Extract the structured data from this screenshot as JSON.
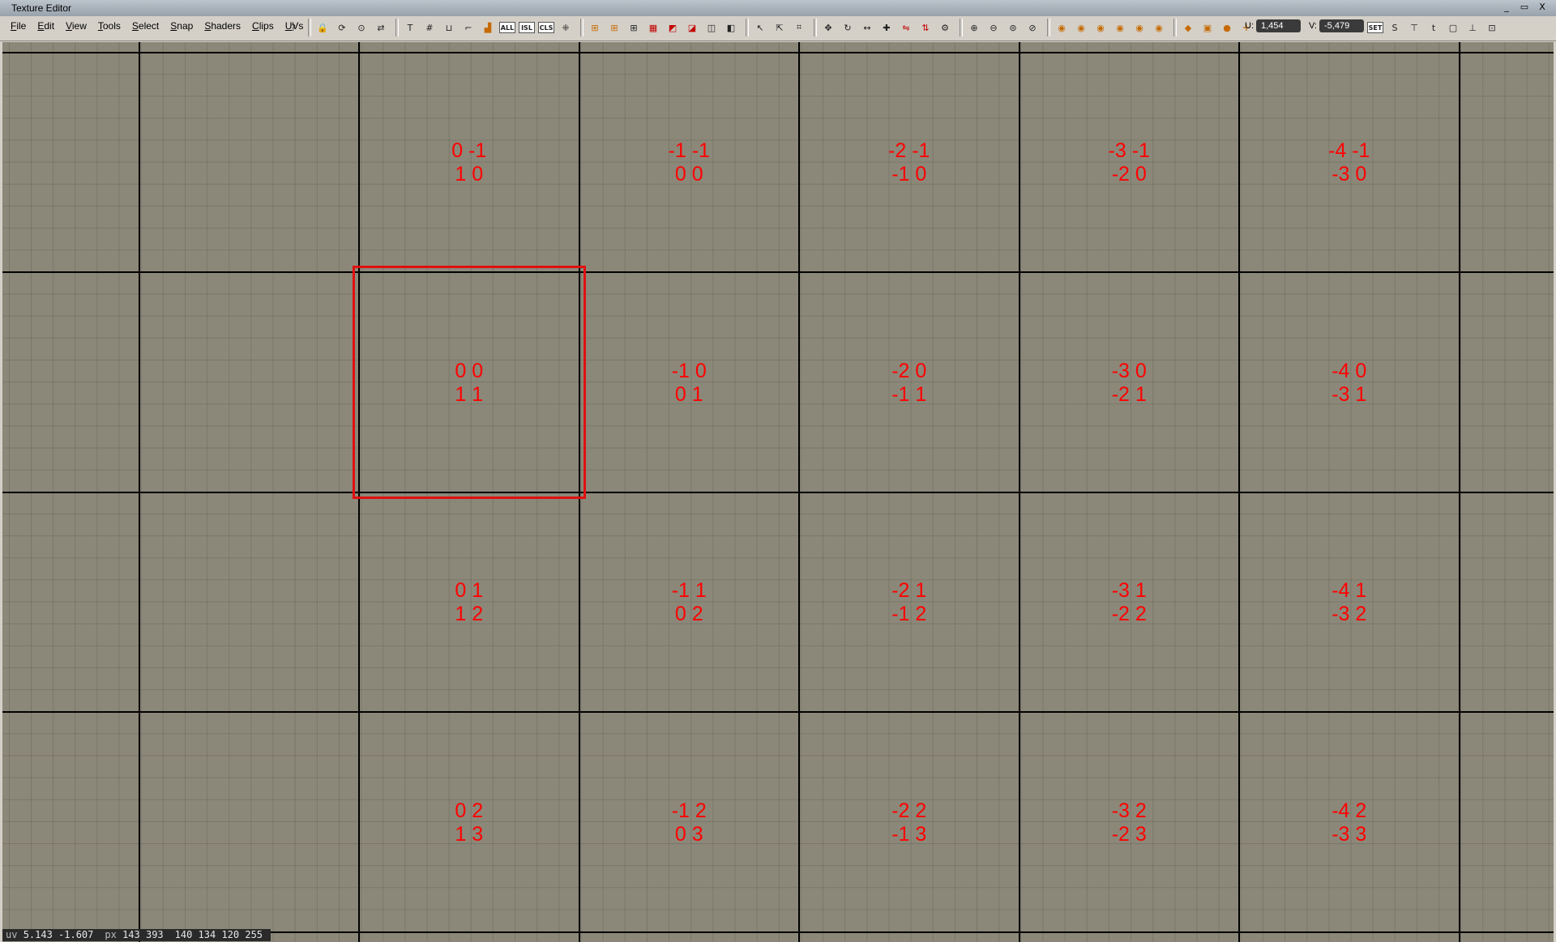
{
  "window": {
    "title": "Texture Editor",
    "minimize": "_",
    "restore": "▭",
    "close": "X"
  },
  "menu": [
    "File",
    "Edit",
    "View",
    "Tools",
    "Select",
    "Snap",
    "Shaders",
    "Clips",
    "UVs"
  ],
  "toolbar": {
    "icons": [
      {
        "name": "help-icon",
        "glyph": "?"
      },
      {
        "sep": true
      },
      {
        "name": "lock-icon",
        "glyph": "🔒"
      },
      {
        "name": "refresh-icon",
        "glyph": "⟳"
      },
      {
        "name": "snapshot-icon",
        "glyph": "⊙"
      },
      {
        "name": "swap-icon",
        "glyph": "⇄"
      },
      {
        "sep": true
      },
      {
        "name": "text-icon",
        "glyph": "T"
      },
      {
        "name": "grid-icon",
        "glyph": "#"
      },
      {
        "name": "uv-icon",
        "glyph": "⊔"
      },
      {
        "name": "edge-icon",
        "glyph": "⌐"
      },
      {
        "name": "paint-icon",
        "glyph": "▟",
        "cls": "orange"
      },
      {
        "name": "all-button",
        "text": "ALL"
      },
      {
        "name": "isl-button",
        "text": "ISL"
      },
      {
        "name": "cls-button",
        "text": "CLS"
      },
      {
        "name": "pattern-icon",
        "glyph": "⁜"
      },
      {
        "sep": true
      },
      {
        "name": "snap-grid-icon",
        "glyph": "⊞",
        "cls": "orange"
      },
      {
        "name": "snap-points-icon",
        "glyph": "⊞",
        "cls": "orange"
      },
      {
        "name": "snap-edge-icon",
        "glyph": "⊞"
      },
      {
        "name": "checker-icon",
        "glyph": "▦",
        "cls": "red"
      },
      {
        "name": "texture-icon",
        "glyph": "◩",
        "cls": "red"
      },
      {
        "name": "image-icon",
        "glyph": "◪",
        "cls": "red"
      },
      {
        "name": "stamp-icon",
        "glyph": "◫"
      },
      {
        "name": "mirror-icon",
        "glyph": "◧"
      },
      {
        "sep": true
      },
      {
        "name": "pointer-icon",
        "glyph": "↖"
      },
      {
        "name": "pointer-plus-icon",
        "glyph": "⇱"
      },
      {
        "name": "crop-icon",
        "glyph": "⌗"
      },
      {
        "sep": true
      },
      {
        "name": "move-icon",
        "glyph": "✥"
      },
      {
        "name": "rotate-icon",
        "glyph": "↻"
      },
      {
        "name": "scale-h-icon",
        "glyph": "↔"
      },
      {
        "name": "plus-icon",
        "glyph": "✚"
      },
      {
        "name": "flip-icon",
        "glyph": "⇋",
        "cls": "red"
      },
      {
        "name": "flip-v-icon",
        "glyph": "⇅",
        "cls": "red"
      },
      {
        "name": "settings-icon",
        "glyph": "⚙"
      },
      {
        "sep": true
      },
      {
        "name": "zoom-in-icon",
        "glyph": "⊕"
      },
      {
        "name": "zoom-out-icon",
        "glyph": "⊖"
      },
      {
        "name": "zoom-fit-icon",
        "glyph": "⊜"
      },
      {
        "name": "zoom-sel-icon",
        "glyph": "⊘"
      },
      {
        "sep": true
      },
      {
        "name": "view-1-icon",
        "glyph": "◉",
        "cls": "orange"
      },
      {
        "name": "view-2-icon",
        "glyph": "◉",
        "cls": "orange"
      },
      {
        "name": "view-3-icon",
        "glyph": "◉",
        "cls": "orange"
      },
      {
        "name": "view-4-icon",
        "glyph": "◉",
        "cls": "orange"
      },
      {
        "name": "view-5-icon",
        "glyph": "◉",
        "cls": "orange"
      },
      {
        "name": "view-6-icon",
        "glyph": "◉",
        "cls": "orange"
      },
      {
        "sep": true
      },
      {
        "name": "cube-icon",
        "glyph": "◆",
        "cls": "orange"
      },
      {
        "name": "box-icon",
        "glyph": "▣",
        "cls": "orange"
      },
      {
        "name": "sphere-icon",
        "glyph": "●",
        "cls": "orange"
      },
      {
        "name": "cross-icon",
        "glyph": "✛",
        "cls": "orange"
      },
      {
        "name": "cylinder-icon",
        "glyph": "⊚",
        "cls": "orange"
      }
    ],
    "u_label": "U:",
    "u_value": "1,454",
    "v_label": "V:",
    "v_value": "-5,479",
    "set_label": "SET",
    "trailing_icons": [
      "s-icon",
      "t-bracket-icon",
      "t-icon",
      "frame-icon",
      "align-icon",
      "layout-icon"
    ]
  },
  "cells": [
    {
      "col": 0,
      "row": 0,
      "l1": "0 -1",
      "l2": "1 0"
    },
    {
      "col": 1,
      "row": 0,
      "l1": "-1 -1",
      "l2": "0 0"
    },
    {
      "col": 2,
      "row": 0,
      "l1": "-2 -1",
      "l2": "-1 0"
    },
    {
      "col": 3,
      "row": 0,
      "l1": "-3 -1",
      "l2": "-2 0"
    },
    {
      "col": 4,
      "row": 0,
      "l1": "-4 -1",
      "l2": "-3 0"
    },
    {
      "col": 0,
      "row": 1,
      "l1": "0 0",
      "l2": "1 1"
    },
    {
      "col": 1,
      "row": 1,
      "l1": "-1 0",
      "l2": "0 1"
    },
    {
      "col": 2,
      "row": 1,
      "l1": "-2 0",
      "l2": "-1 1"
    },
    {
      "col": 3,
      "row": 1,
      "l1": "-3 0",
      "l2": "-2 1"
    },
    {
      "col": 4,
      "row": 1,
      "l1": "-4 0",
      "l2": "-3 1"
    },
    {
      "col": 0,
      "row": 2,
      "l1": "0 1",
      "l2": "1 2"
    },
    {
      "col": 1,
      "row": 2,
      "l1": "-1 1",
      "l2": "0 2"
    },
    {
      "col": 2,
      "row": 2,
      "l1": "-2 1",
      "l2": "-1 2"
    },
    {
      "col": 3,
      "row": 2,
      "l1": "-3 1",
      "l2": "-2 2"
    },
    {
      "col": 4,
      "row": 2,
      "l1": "-4 1",
      "l2": "-3 2"
    },
    {
      "col": 0,
      "row": 3,
      "l1": "0 2",
      "l2": "1 3"
    },
    {
      "col": 1,
      "row": 3,
      "l1": "-1 2",
      "l2": "0 3"
    },
    {
      "col": 2,
      "row": 3,
      "l1": "-2 2",
      "l2": "-1 3"
    },
    {
      "col": 3,
      "row": 3,
      "l1": "-3 2",
      "l2": "-2 3"
    },
    {
      "col": 4,
      "row": 3,
      "l1": "-4 2",
      "l2": "-3 3"
    }
  ],
  "selected_tile": {
    "col": 0,
    "row": 1
  },
  "status": {
    "uv_label": "uv",
    "uv_value": "5.143  -1.607",
    "px_label": "px",
    "px_value": "143   393",
    "rgba": "140  134  120  255"
  },
  "colors": {
    "viewport_bg": "#8c8879",
    "label_red": "#ff0000",
    "selection_red": "#e01010"
  }
}
